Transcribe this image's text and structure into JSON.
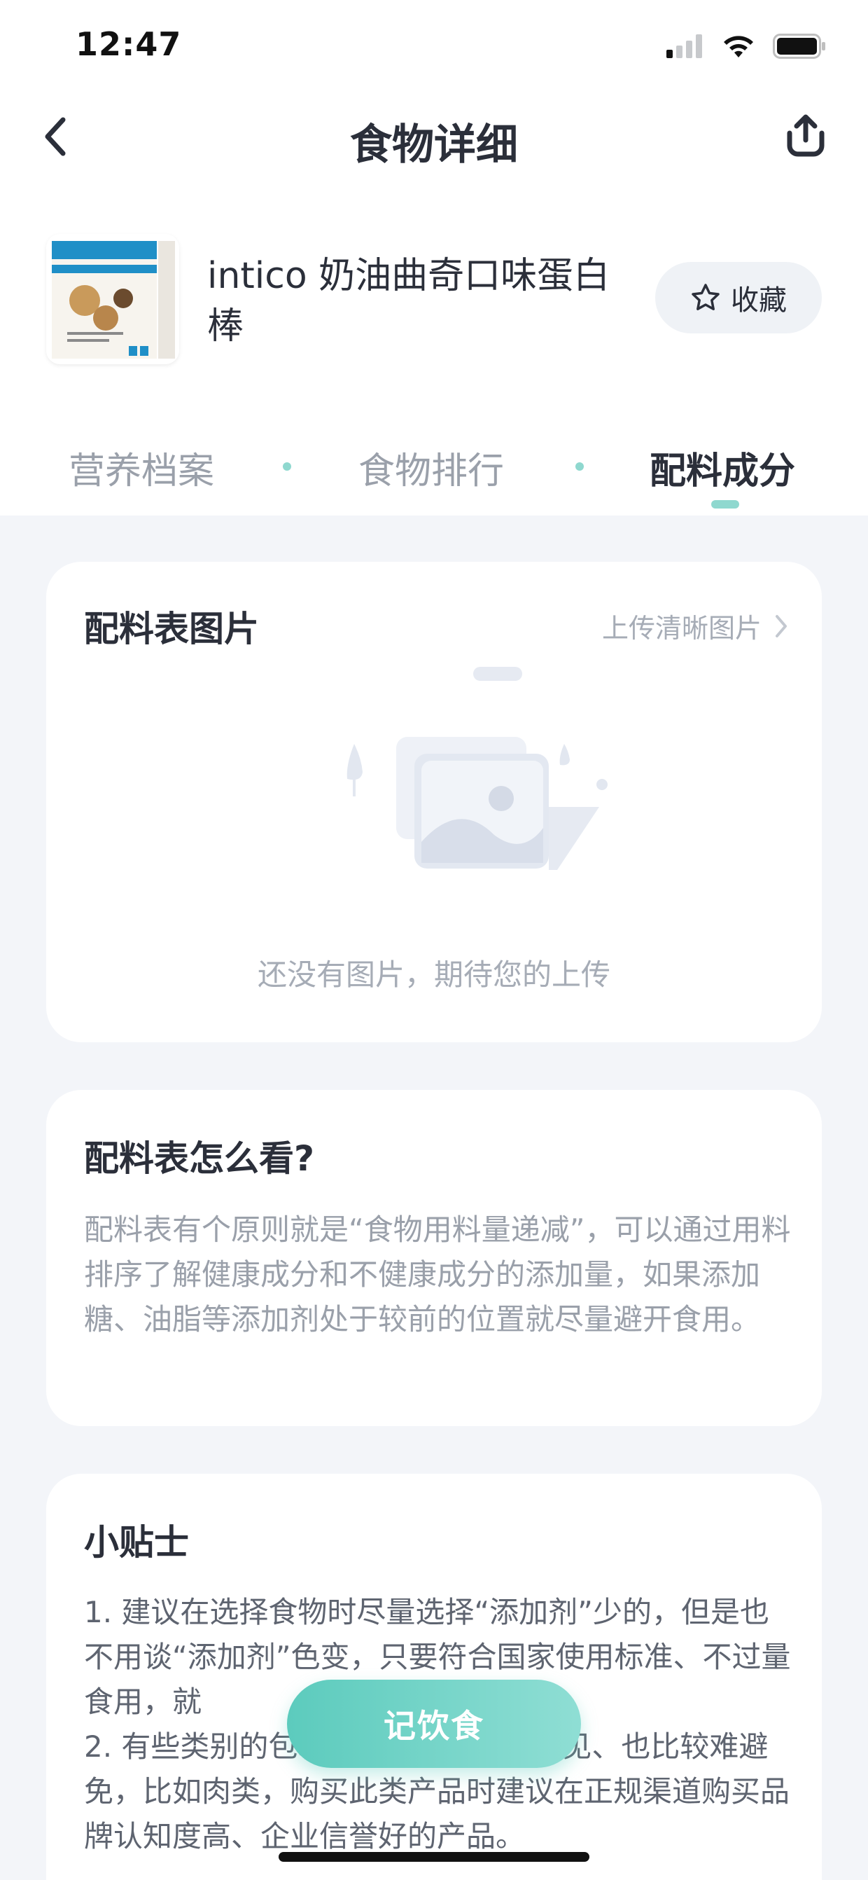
{
  "status_bar": {
    "time": "12:47"
  },
  "nav": {
    "title": "食物详细"
  },
  "product": {
    "name": "intico 奶油曲奇口味蛋白棒",
    "favorite_label": "收藏"
  },
  "tabs": [
    {
      "label": "营养档案",
      "active": false
    },
    {
      "label": "食物排行",
      "active": false
    },
    {
      "label": "配料成分",
      "active": true
    }
  ],
  "ingredients_image": {
    "title": "配料表图片",
    "upload_link": "上传清晰图片",
    "empty_text": "还没有图片，期待您的上传"
  },
  "how_to_read": {
    "title": "配料表怎么看?",
    "body": "配料表有个原则就是“食物用料量递减”，可以通过用料排序了解健康成分和不健康成分的添加量，如果添加糖、油脂等添加剂处于较前的位置就尽量避开食用。"
  },
  "tips": {
    "title": "小贴士",
    "item1": "1. 建议在选择食物时尽量选择“添加剂”少的，但是也不用谈“添加剂”色变，只要符合国家使用标准、不过量食用，就",
    "item2": "2. 有些类别的包装食品添加剂比较常见、也比较难避免，比如肉类，购买此类产品时建议在正规渠道购买品牌认知度高、企业信誉好的产品。"
  },
  "record_button": {
    "label": "记饮食"
  },
  "colors": {
    "accent": "#8fd8cf",
    "button": "#5ccbbd",
    "background": "#f3f5f9"
  }
}
